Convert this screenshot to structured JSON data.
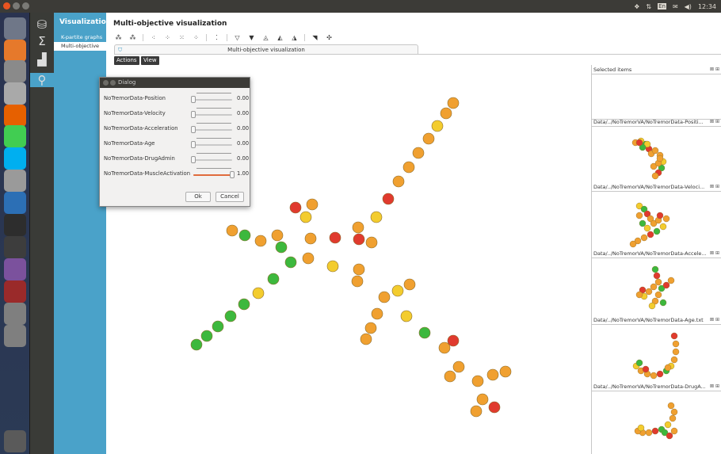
{
  "topbar": {
    "clock": "12:34",
    "tray_keyboard": "En",
    "colors": {
      "bar": "#3c3b37",
      "close": "#e95420",
      "min": "#7a7a76",
      "max": "#7a7a76"
    }
  },
  "launcher": {
    "items": [
      {
        "icon": "ubuntu-dash-icon",
        "color": "#6f7788"
      },
      {
        "icon": "files-folder-icon",
        "color": "#e6792b"
      },
      {
        "icon": "document-viewer-icon",
        "color": "#8a8a8a"
      },
      {
        "icon": "text-editor-icon",
        "color": "#a9a9a9"
      },
      {
        "icon": "firefox-icon",
        "color": "#e66000"
      },
      {
        "icon": "qt-creator-icon",
        "color": "#41cd52"
      },
      {
        "icon": "skype-icon",
        "color": "#00aff0"
      },
      {
        "icon": "disk-drive-icon",
        "color": "#9a9a9a"
      },
      {
        "icon": "thunderbird-icon",
        "color": "#2c6fb5"
      },
      {
        "icon": "terminal-icon",
        "color": "#2d2d2d"
      },
      {
        "icon": "system-monitor-icon",
        "color": "#3d3d3d"
      },
      {
        "icon": "viber-icon",
        "color": "#7b519d"
      },
      {
        "icon": "globe-red-icon",
        "color": "#9a2a2a"
      },
      {
        "icon": "unknown-app-icon",
        "color": "#7f7f7f"
      },
      {
        "icon": "unknown-app-icon",
        "color": "#7f7f7f"
      }
    ],
    "trash_icon": "trash-icon"
  },
  "nav2": {
    "items": [
      {
        "icon": "database-icon",
        "glyph": "⛁"
      },
      {
        "icon": "sigma-icon",
        "glyph": "Σ"
      },
      {
        "icon": "bar-chart-icon",
        "glyph": "▟"
      },
      {
        "icon": "search-icon",
        "glyph": "⚲",
        "active": true
      }
    ]
  },
  "nav3": {
    "title": "Visualizations",
    "items": [
      "K-partite graphs",
      "Multi-objective"
    ],
    "selected": 1,
    "color": "#4aa2c9"
  },
  "main": {
    "title": "Multi-objective visualization",
    "tab_label": "Multi-objective visualization",
    "actions_label": "Actions",
    "view_label": "View"
  },
  "toolbar": {
    "groups": [
      [
        "⁂",
        "⁂"
      ],
      [
        "⁖",
        "⁘",
        "⁙",
        "⁘"
      ],
      [
        "⁚"
      ],
      [
        "▽",
        "▼",
        "◬",
        "◭",
        "◮"
      ],
      [
        "◥",
        "✣"
      ]
    ]
  },
  "dialog": {
    "title": "Dialog",
    "sliders": [
      {
        "label": "NoTremorData-Position",
        "value": 0.0,
        "display": "0.00"
      },
      {
        "label": "NoTremorData-Velocity",
        "value": 0.0,
        "display": "0.00"
      },
      {
        "label": "NoTremorData-Acceleration",
        "value": 0.0,
        "display": "0.00"
      },
      {
        "label": "NoTremorData-Age",
        "value": 0.0,
        "display": "0.00"
      },
      {
        "label": "NoTremorData-DrugAdmin",
        "value": 0.0,
        "display": "0.00"
      },
      {
        "label": "NoTremorData-MuscleActivation",
        "value": 1.0,
        "display": "1.00"
      }
    ],
    "ok_label": "Ok",
    "cancel_label": "Cancel"
  },
  "right_panel": {
    "selected_header": "Selected items",
    "thumbs": [
      {
        "label": "Data/../NoTremorVA/NoTremorData-Positi..."
      },
      {
        "label": "Data/../NoTremorVA/NoTremorData-Veloci..."
      },
      {
        "label": "Data/../NoTremorVA/NoTremorData-Accele..."
      },
      {
        "label": "Data/../NoTremorVA/NoTremorData-Age.txt"
      },
      {
        "label": "Data/../NoTremorVA/NoTremorData-DrugA..."
      }
    ],
    "icons_glyph": "⊠ ⊞"
  },
  "scatter": {
    "colors": {
      "green": "#3db83d",
      "orange": "#f0a030",
      "yellow": "#f3cc2e",
      "red": "#e03a2e",
      "stroke": "#8a6a2a"
    },
    "points": [
      [
        572,
        130,
        "o"
      ],
      [
        563,
        143,
        "o"
      ],
      [
        552,
        159,
        "y"
      ],
      [
        541,
        175,
        "o"
      ],
      [
        528,
        193,
        "o"
      ],
      [
        516,
        211,
        "o"
      ],
      [
        503,
        229,
        "o"
      ],
      [
        490,
        251,
        "r"
      ],
      [
        475,
        274,
        "y"
      ],
      [
        452,
        287,
        "o"
      ],
      [
        469,
        306,
        "o"
      ],
      [
        453,
        302,
        "r"
      ],
      [
        423,
        300,
        "r"
      ],
      [
        392,
        301,
        "o"
      ],
      [
        373,
        262,
        "r"
      ],
      [
        386,
        274,
        "y"
      ],
      [
        394,
        258,
        "o"
      ],
      [
        350,
        297,
        "o"
      ],
      [
        329,
        304,
        "o"
      ],
      [
        309,
        297,
        "g"
      ],
      [
        293,
        291,
        "o"
      ],
      [
        355,
        312,
        "g"
      ],
      [
        389,
        326,
        "o"
      ],
      [
        420,
        336,
        "y"
      ],
      [
        367,
        331,
        "g"
      ],
      [
        453,
        340,
        "o"
      ],
      [
        451,
        355,
        "o"
      ],
      [
        345,
        352,
        "g"
      ],
      [
        326,
        370,
        "y"
      ],
      [
        308,
        384,
        "g"
      ],
      [
        291,
        399,
        "g"
      ],
      [
        275,
        412,
        "g"
      ],
      [
        261,
        424,
        "g"
      ],
      [
        248,
        435,
        "g"
      ],
      [
        517,
        359,
        "o"
      ],
      [
        502,
        367,
        "y"
      ],
      [
        485,
        375,
        "o"
      ],
      [
        476,
        396,
        "o"
      ],
      [
        513,
        399,
        "y"
      ],
      [
        468,
        414,
        "o"
      ],
      [
        462,
        428,
        "o"
      ],
      [
        536,
        420,
        "g"
      ],
      [
        561,
        439,
        "o"
      ],
      [
        572,
        430,
        "r"
      ],
      [
        579,
        463,
        "o"
      ],
      [
        568,
        475,
        "o"
      ],
      [
        603,
        481,
        "o"
      ],
      [
        622,
        473,
        "o"
      ],
      [
        638,
        469,
        "o"
      ],
      [
        609,
        504,
        "o"
      ],
      [
        624,
        514,
        "r"
      ],
      [
        601,
        519,
        "o"
      ]
    ]
  }
}
